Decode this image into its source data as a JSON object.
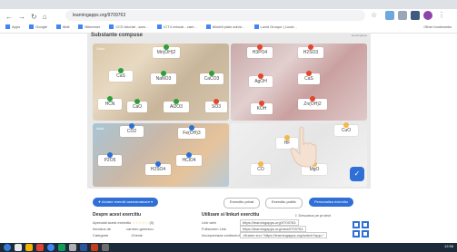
{
  "browser": {
    "url": "learningapps.org/9709763",
    "bookmarks": [
      "Apps",
      "Google",
      "Mail",
      "Nikmeser",
      "CCS tutorial - sam...",
      "ICT4 rebook - cam...",
      "Modell plain sobre...",
      "Lucid Groupe | Lucid..."
    ],
    "other": "Other bookmarks"
  },
  "app": {
    "title": "Substante compuse",
    "corner": "learningapps",
    "panels": [
      {
        "label": "Oxizi"
      },
      {
        "label": ""
      },
      {
        "label": "Acizi"
      },
      {
        "label": ""
      }
    ],
    "chips": [
      {
        "text": "Mn(OH)2",
        "color": "#2e9e3a"
      },
      {
        "text": "H3PO4",
        "color": "#e4452b"
      },
      {
        "text": "H2SO3",
        "color": "#e4452b"
      },
      {
        "text": "CaS",
        "color": "#2e9e3a"
      },
      {
        "text": "NaNO3",
        "color": "#2e9e3a"
      },
      {
        "text": "CaCO3",
        "color": "#2e9e3a"
      },
      {
        "text": "AgOH",
        "color": "#e4452b"
      },
      {
        "text": "CaS",
        "color": "#e4452b"
      },
      {
        "text": "HCN",
        "color": "#2e9e3a"
      },
      {
        "text": "CaO",
        "color": "#2e9e3a"
      },
      {
        "text": "Al2O3",
        "color": "#2e9e3a"
      },
      {
        "text": "SO3",
        "color": "#e4452b"
      },
      {
        "text": "KOH",
        "color": "#e4452b"
      },
      {
        "text": "Zn(OH)2",
        "color": "#e4452b"
      },
      {
        "text": "CO2",
        "color": "#2a6fd6"
      },
      {
        "text": "Fe(OH)3",
        "color": "#2a6fd6"
      },
      {
        "text": "HF",
        "color": "#f2b84b"
      },
      {
        "text": "CuO",
        "color": "#f2b84b"
      },
      {
        "text": "P2O5",
        "color": "#2a6fd6"
      },
      {
        "text": "H2SO4",
        "color": "#2a6fd6"
      },
      {
        "text": "HClO4",
        "color": "#2a6fd6"
      },
      {
        "text": "CO",
        "color": "#f2b84b"
      },
      {
        "text": "MgO",
        "color": "#f2b84b"
      }
    ]
  },
  "actions": {
    "similar": "Aiutare exerciti asemanatoare",
    "private": "Exercitiu privat",
    "public": "Exercitiu public",
    "personalize": "Personaliza exercitiu"
  },
  "info": {
    "about_title": "Despre acest exercitiu",
    "about_rows": [
      {
        "label": "Apreciati acest exercitiu",
        "value": "(0)"
      },
      {
        "label": "Introdus de",
        "value": "carmen.genescu"
      },
      {
        "label": "Categorie",
        "value": "Chimie"
      }
    ],
    "links_title": "Utilizare si linkuri exercitiu",
    "download": "Descarca pe proiect",
    "link_rows": [
      {
        "label": "Link web",
        "value": "https://learningapps.org/9709763"
      },
      {
        "label": "Fullscreen Link",
        "value": "https://learningapps.org/view9709763"
      },
      {
        "label": "Incorporeaza continutul",
        "value": "<iframe src=\"https://learningapps.org/watch?app=\""
      }
    ]
  },
  "taskbar": {
    "time": "12:56"
  },
  "colors": {
    "accent": "#2f6fd6",
    "green": "#2e9e3a",
    "red": "#e4452b",
    "blue": "#2a6fd6",
    "yellow": "#f2b84b"
  }
}
